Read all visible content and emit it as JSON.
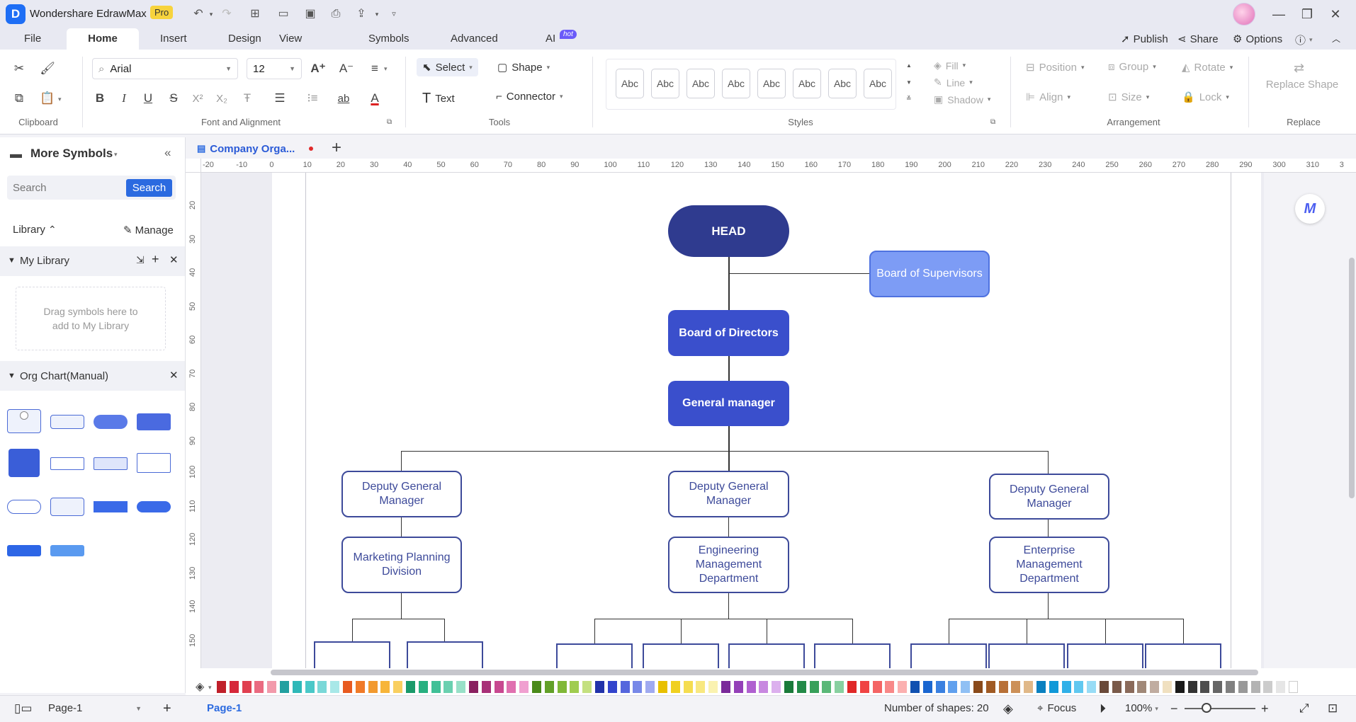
{
  "app": {
    "title": "Wondershare EdrawMax",
    "badge": "Pro"
  },
  "menu": {
    "tabs": [
      "File",
      "Home",
      "Insert",
      "Design",
      "View",
      "Symbols",
      "Advanced",
      "AI"
    ],
    "hot_badge": "hot",
    "publish": "Publish",
    "share": "Share",
    "options": "Options"
  },
  "ribbon": {
    "font_name": "Arial",
    "font_size": "12",
    "select": "Select",
    "shape": "Shape",
    "text": "Text",
    "connector": "Connector",
    "abc": [
      "Abc",
      "Abc",
      "Abc",
      "Abc",
      "Abc",
      "Abc",
      "Abc",
      "Abc"
    ],
    "fill": "Fill",
    "line": "Line",
    "shadow": "Shadow",
    "position": "Position",
    "group": "Group",
    "rotate": "Rotate",
    "align": "Align",
    "size": "Size",
    "lock": "Lock",
    "replace": "Replace Shape",
    "groups": {
      "clipboard": "Clipboard",
      "font": "Font and Alignment",
      "tools": "Tools",
      "styles": "Styles",
      "arrangement": "Arrangement",
      "replace": "Replace"
    }
  },
  "sidebar": {
    "title": "More Symbols",
    "search_placeholder": "Search",
    "search_btn": "Search",
    "library": "Library",
    "manage": "Manage",
    "my_library": "My Library",
    "drag_hint": "Drag symbols here to add to My Library",
    "org_chart": "Org Chart(Manual)"
  },
  "document": {
    "tab": "Company Orga..."
  },
  "ruler": {
    "h": [
      "-20",
      "-10",
      "0",
      "10",
      "20",
      "30",
      "40",
      "50",
      "60",
      "70",
      "80",
      "90",
      "100",
      "110",
      "120",
      "130",
      "140",
      "150",
      "160",
      "170",
      "180",
      "190",
      "200",
      "210",
      "220",
      "230",
      "240",
      "250",
      "260",
      "270",
      "280",
      "290",
      "300",
      "310",
      "3"
    ],
    "v": [
      "20",
      "30",
      "40",
      "50",
      "60",
      "70",
      "80",
      "90",
      "100",
      "110",
      "120",
      "130",
      "140",
      "150"
    ]
  },
  "chart": {
    "head": "HEAD",
    "supervisors": "Board of Supervisors",
    "directors": "Board of Directors",
    "gm": "General manager",
    "deputy1": "Deputy General Manager",
    "deputy2": "Deputy General Manager",
    "deputy3": "Deputy General Manager",
    "dept1": "Marketing Planning Division",
    "dept2": "Engineering Management Department",
    "dept3": "Enterprise Management Department"
  },
  "palette": [
    "#c0202a",
    "#d6283a",
    "#e04050",
    "#ea6a80",
    "#f29aab",
    "#22a0a0",
    "#2fb8b8",
    "#4ac8c8",
    "#7ad8d8",
    "#a8e8e8",
    "#e85a20",
    "#f07a28",
    "#f29a30",
    "#f7b53a",
    "#f9cf60",
    "#1a9a6a",
    "#28b080",
    "#40c097",
    "#6ad0b0",
    "#98e0c8",
    "#8a2060",
    "#a83078",
    "#c84890",
    "#e070b0",
    "#f0a0d0",
    "#4a8a1a",
    "#62a028",
    "#80b838",
    "#a0cc50",
    "#c4e080",
    "#2233aa",
    "#3344cc",
    "#5566dd",
    "#7788e8",
    "#a0aaf0",
    "#e8c000",
    "#f0d020",
    "#f5dd50",
    "#f8e880",
    "#faf2b0",
    "#7a2a9a",
    "#9440b8",
    "#b060d0",
    "#c888e0",
    "#dcb0ee",
    "#1a7a3a",
    "#238a48",
    "#38a05a",
    "#5ab878",
    "#88d0a0",
    "#e02828",
    "#f04444",
    "#f46464",
    "#f88888",
    "#fbb0b0",
    "#1050b0",
    "#1a66d0",
    "#3a80e0",
    "#60a0ee",
    "#90c0f4",
    "#8a4a1a",
    "#a05a24",
    "#b87038",
    "#cc9058",
    "#e0b888",
    "#0a80c0",
    "#1098d8",
    "#30b0e8",
    "#60c8f0",
    "#98dcf6",
    "#6a4a3a",
    "#7a5a4a",
    "#8a6a5a",
    "#a08878",
    "#c0aca0",
    "#f0e0c0",
    "#1a1a1a",
    "#333333",
    "#4d4d4d",
    "#666666",
    "#808080",
    "#999999",
    "#b3b3b3",
    "#cccccc",
    "#e6e6e6",
    "#ffffff"
  ],
  "status": {
    "page_sel": "Page-1",
    "page_tab": "Page-1",
    "shapes": "Number of shapes: 20",
    "focus": "Focus",
    "zoom": "100%"
  }
}
